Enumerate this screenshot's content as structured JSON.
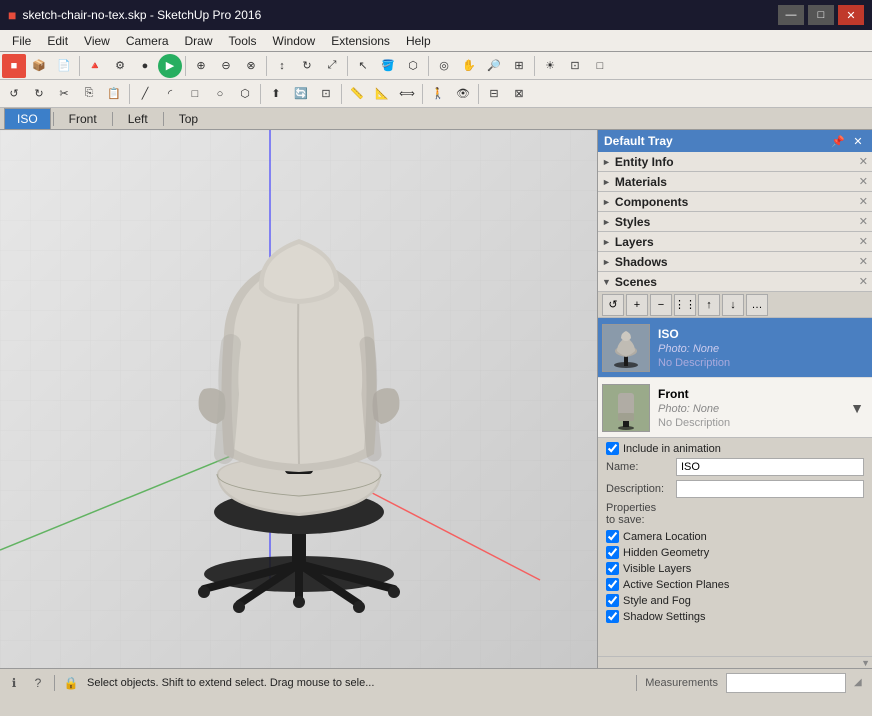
{
  "titlebar": {
    "icon": "■",
    "title": "sketch-chair-no-tex.skp - SketchUp Pro 2016",
    "controls": [
      "—",
      "□",
      "✕"
    ]
  },
  "menubar": {
    "items": [
      "File",
      "Edit",
      "View",
      "Camera",
      "Draw",
      "Tools",
      "Window",
      "Extensions",
      "Help"
    ]
  },
  "toolbar1": {
    "buttons": [
      "🔴",
      "📦",
      "📄",
      "🔺",
      "⚙",
      "👁",
      "●",
      "▶",
      "✚",
      "~",
      "►",
      "↕",
      "⚡",
      "🔗",
      "✦",
      "🔲",
      "⬜",
      "▦",
      "…",
      "?",
      "📐",
      "🔧",
      "📏",
      "🔎",
      "⌘"
    ]
  },
  "toolbar2": {
    "buttons": [
      "↺",
      "🔎+",
      "🔎-",
      "↔",
      "↕",
      "⬛",
      "●",
      "◎",
      "○",
      "⬡",
      "⬢",
      "〇",
      "✒",
      "✏",
      "⊕",
      "△",
      "⬟",
      "⬠",
      "✦",
      "✧",
      "⚖",
      "〰",
      "〰",
      "~",
      "〰"
    ]
  },
  "tabs": {
    "items": [
      "ISO",
      "Front",
      "Left",
      "Top"
    ],
    "active": "ISO"
  },
  "viewport": {
    "background": "#e0e0e0"
  },
  "tray": {
    "title": "Default Tray",
    "sections": [
      {
        "label": "Entity Info",
        "collapsed": true,
        "arrow": "►"
      },
      {
        "label": "Materials",
        "collapsed": true,
        "arrow": "►"
      },
      {
        "label": "Components",
        "collapsed": true,
        "arrow": "►"
      },
      {
        "label": "Styles",
        "collapsed": true,
        "arrow": "►"
      },
      {
        "label": "Layers",
        "collapsed": true,
        "arrow": "►"
      },
      {
        "label": "Shadows",
        "collapsed": true,
        "arrow": "►"
      },
      {
        "label": "Scenes",
        "collapsed": false,
        "arrow": "▼"
      }
    ]
  },
  "scenes": {
    "toolbar_buttons": [
      "↺",
      "+",
      "−",
      "⋮⋮",
      "↑",
      "↓",
      "…"
    ],
    "items": [
      {
        "name": "ISO",
        "photo": "None",
        "description": "No Description",
        "selected": true
      },
      {
        "name": "Front",
        "photo": "None",
        "description": "No Description",
        "selected": false
      }
    ],
    "include_in_animation_label": "Include in animation",
    "name_label": "Name:",
    "name_value": "ISO",
    "description_label": "Description:",
    "description_value": "",
    "properties_label": "Properties to save:",
    "properties": [
      {
        "label": "Camera Location",
        "checked": true
      },
      {
        "label": "Hidden Geometry",
        "checked": true
      },
      {
        "label": "Visible Layers",
        "checked": true
      },
      {
        "label": "Active Section Planes",
        "checked": true
      },
      {
        "label": "Style and Fog",
        "checked": true
      },
      {
        "label": "Shadow Settings",
        "checked": true
      }
    ]
  },
  "statusbar": {
    "message": "Select objects. Shift to extend select. Drag mouse to sele...",
    "measurements_label": "Measurements",
    "measurements_value": ""
  }
}
